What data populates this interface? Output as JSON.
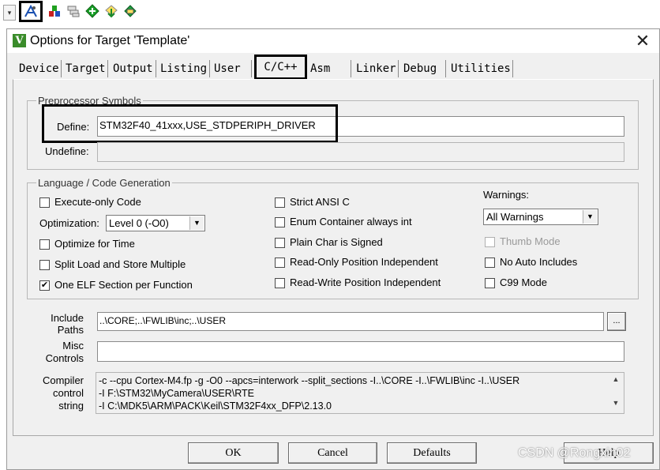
{
  "toolbar": {
    "icons": [
      "dropdown-arrow",
      "target-options-icon",
      "component-icon",
      "stack-icon",
      "green-diamond-icon",
      "arrow-pack-icon",
      "books-icon"
    ]
  },
  "dialog": {
    "title": "Options for Target 'Template'",
    "close": "✕",
    "icon_letter": "V"
  },
  "tabs": [
    "Device",
    "Target",
    "Output",
    "Listing",
    "User",
    "C/C++",
    "Asm",
    "Linker",
    "Debug",
    "Utilities"
  ],
  "preprocessor": {
    "group_label": "Preprocessor Symbols",
    "define_label": "Define:",
    "define_value": "STM32F40_41xxx,USE_STDPERIPH_DRIVER",
    "undefine_label": "Undefine:",
    "undefine_value": ""
  },
  "language": {
    "group_label": "Language / Code Generation",
    "execute_only": {
      "label": "Execute-only Code",
      "checked": false
    },
    "optimization_label": "Optimization:",
    "optimization_value": "Level 0 (-O0)",
    "optimize_time": {
      "label": "Optimize for Time",
      "checked": false
    },
    "split_load": {
      "label": "Split Load and Store Multiple",
      "checked": false
    },
    "one_elf": {
      "label": "One ELF Section per Function",
      "checked": true
    },
    "strict_ansi": {
      "label": "Strict ANSI C",
      "checked": false
    },
    "enum_container": {
      "label": "Enum Container always int",
      "checked": false
    },
    "plain_char": {
      "label": "Plain Char is Signed",
      "checked": false
    },
    "ropi": {
      "label": "Read-Only Position Independent",
      "checked": false
    },
    "rwpi": {
      "label": "Read-Write Position Independent",
      "checked": false
    },
    "warnings_label": "Warnings:",
    "warnings_value": "All Warnings",
    "thumb_mode": {
      "label": "Thumb Mode",
      "checked": false
    },
    "no_auto_includes": {
      "label": "No Auto Includes",
      "checked": false
    },
    "c99_mode": {
      "label": "C99 Mode",
      "checked": false
    }
  },
  "include": {
    "label_line1": "Include",
    "label_line2": "Paths",
    "value": "..\\CORE;..\\FWLIB\\inc;..\\USER",
    "browse": "..."
  },
  "misc": {
    "label_line1": "Misc",
    "label_line2": "Controls",
    "value": ""
  },
  "compiler": {
    "label_line1": "Compiler",
    "label_line2": "control",
    "label_line3": "string",
    "lines": [
      "-c --cpu Cortex-M4.fp -g -O0 --apcs=interwork --split_sections -I..\\CORE -I..\\FWLIB\\inc -I..\\USER",
      "-I F:\\STM32\\MyCamera\\USER\\RTE",
      "-I C:\\MDK5\\ARM\\PACK\\Keil\\STM32F4xx_DFP\\2.13.0"
    ]
  },
  "buttons": {
    "ok": "OK",
    "cancel": "Cancel",
    "defaults": "Defaults",
    "help": "Help"
  },
  "watermark": "CSDN @Rongxin02"
}
